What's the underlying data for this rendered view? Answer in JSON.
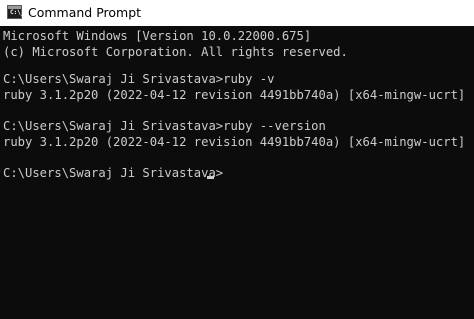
{
  "window": {
    "title": "Command Prompt",
    "icon": "cmd-icon",
    "icon_prompt": "C:\\_"
  },
  "console": {
    "lines": [
      "Microsoft Windows [Version 10.0.22000.675]",
      "(c) Microsoft Corporation. All rights reserved.",
      "",
      "C:\\Users\\Swaraj Ji Srivastava>ruby -v",
      "ruby 3.1.2p20 (2022-04-12 revision 4491bb740a) [x64-mingw-ucrt]",
      "",
      "C:\\Users\\Swaraj Ji Srivastava>ruby --version",
      "ruby 3.1.2p20 (2022-04-12 revision 4491bb740a) [x64-mingw-ucrt]",
      "",
      "C:\\Users\\Swaraj Ji Srivastava>"
    ],
    "background": "#0c0c0c",
    "foreground": "#cccccc"
  }
}
